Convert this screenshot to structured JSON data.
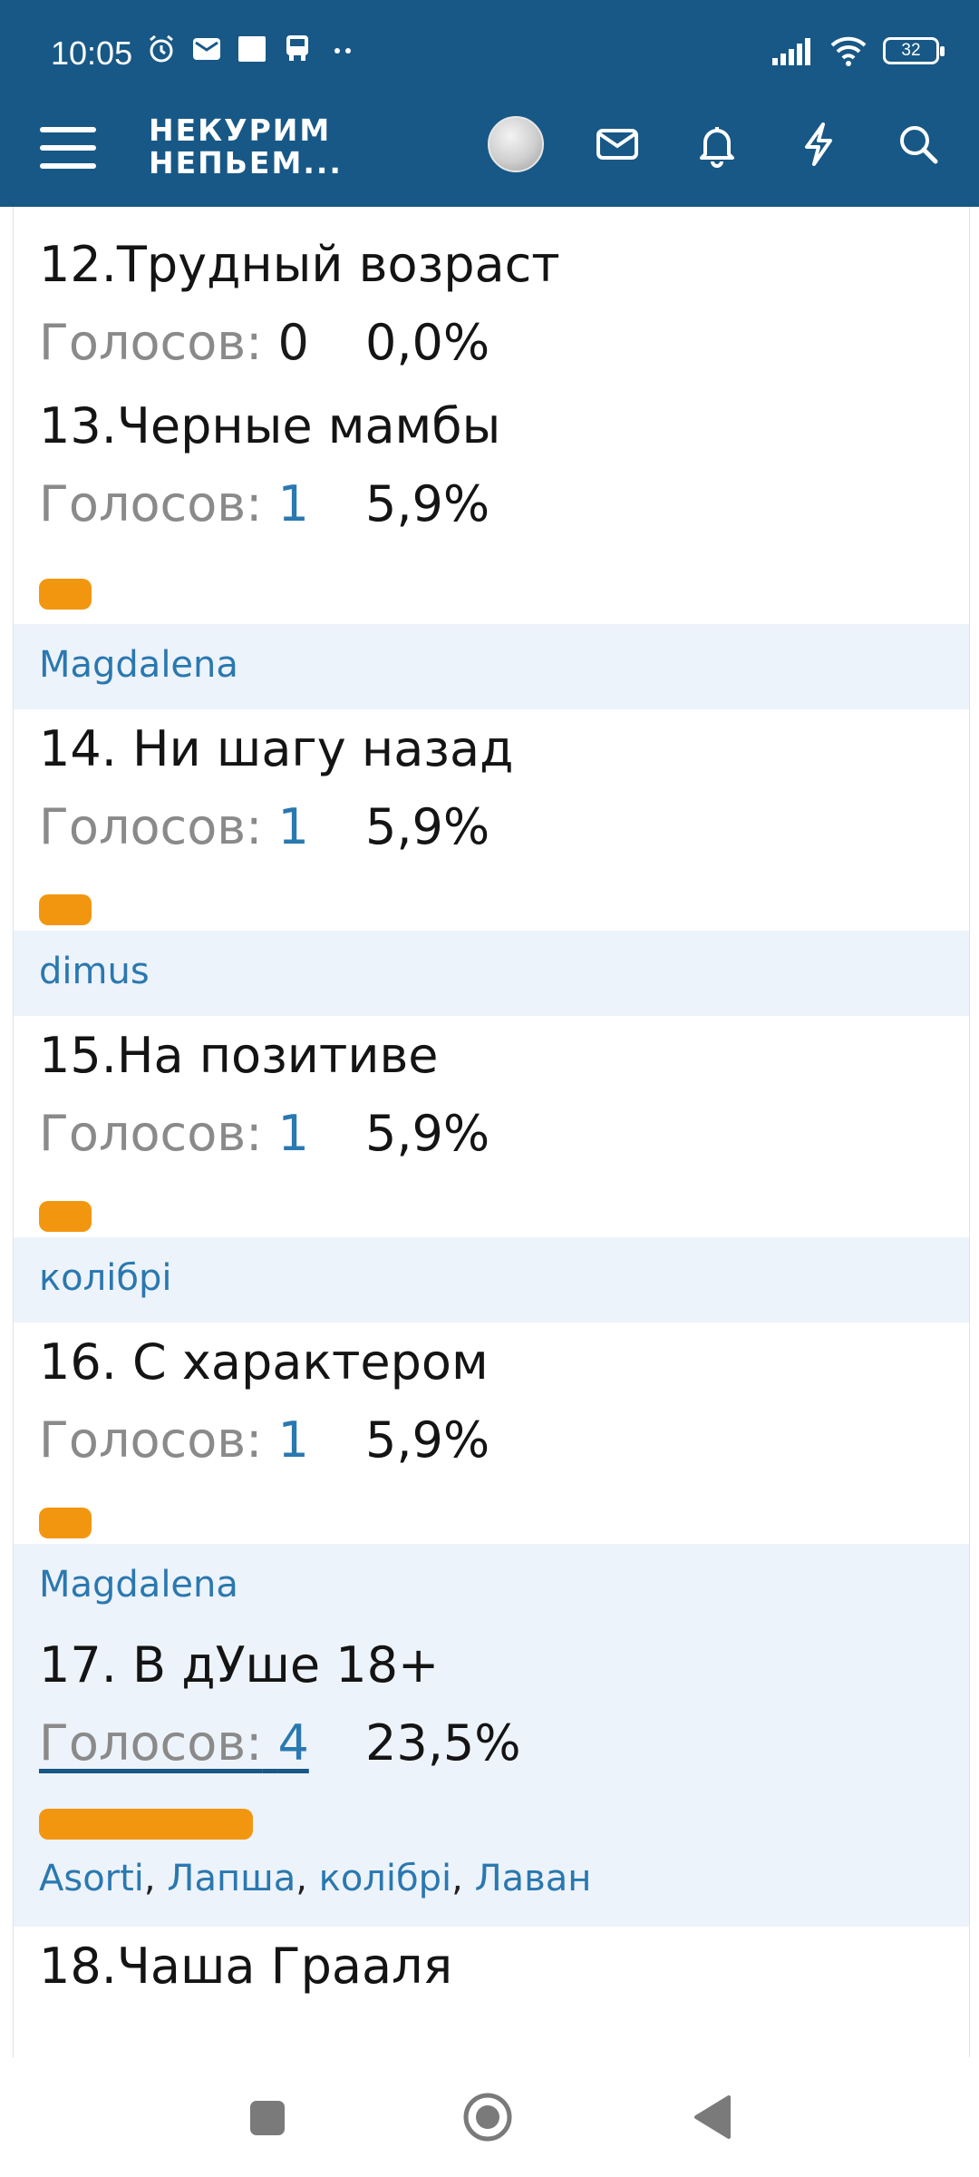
{
  "status_bar": {
    "time": "10:05",
    "battery": "32",
    "icons_left": [
      "alarm-icon",
      "mail-icon",
      "square-icon",
      "bus-icon",
      "more-dots-icon"
    ],
    "icons_right": [
      "signal-icon",
      "wifi-icon",
      "battery-icon"
    ]
  },
  "header": {
    "logo_line1": "НЕКУРИМ",
    "logo_line2": "НЕПЬЕМ...",
    "icons": [
      "menu-icon",
      "avatar",
      "mail-icon",
      "bell-icon",
      "lightning-icon",
      "search-icon"
    ],
    "background": "#185886"
  },
  "poll": {
    "votes_label": "Голосов:",
    "accent": "#f3960f",
    "items": [
      {
        "title": "12.Трудный возраст",
        "votes": "0",
        "percent": "0,0%",
        "share": 0.0,
        "voters": []
      },
      {
        "title": "13.Черные мамбы",
        "votes": "1",
        "percent": "5,9%",
        "share": 0.059,
        "voters": [
          "Magdalena"
        ]
      },
      {
        "title": "14. Ни шагу назад",
        "votes": "1",
        "percent": "5,9%",
        "share": 0.059,
        "voters": [
          "dimus"
        ]
      },
      {
        "title": "15.На позитиве",
        "votes": "1",
        "percent": "5,9%",
        "share": 0.059,
        "voters": [
          "колібрі"
        ]
      },
      {
        "title": "16. С характером",
        "votes": "1",
        "percent": "5,9%",
        "share": 0.059,
        "voters": [
          "Magdalena"
        ]
      },
      {
        "title": "17. В дУше 18+",
        "votes": "4",
        "percent": "23,5%",
        "share": 0.235,
        "voters": [
          "Asorti",
          "Лапша",
          "колібрі",
          "Лаван"
        ]
      },
      {
        "title": "18.Чаша Грааля",
        "votes": "",
        "percent": "",
        "share": 0.0,
        "voters": []
      }
    ],
    "separator": ", "
  },
  "system_nav": {
    "buttons": [
      "recents-button",
      "home-button",
      "back-button"
    ]
  }
}
